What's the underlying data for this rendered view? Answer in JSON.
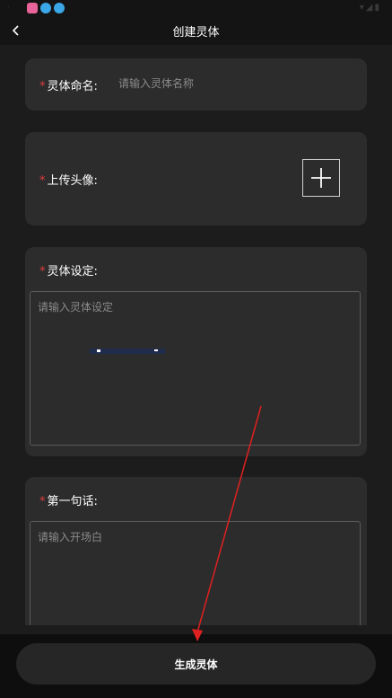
{
  "header": {
    "title": "创建灵体"
  },
  "form": {
    "name": {
      "label": "灵体命名:",
      "placeholder": "请输入灵体名称",
      "value": ""
    },
    "avatar": {
      "label": "上传头像:"
    },
    "setting": {
      "label": "灵体设定:",
      "placeholder": "请输入灵体设定",
      "value": ""
    },
    "first_sentence": {
      "label": "第一句话:",
      "placeholder": "请输入开场白",
      "value": ""
    },
    "required_mark": "*"
  },
  "footer": {
    "generate_label": "生成灵体"
  },
  "icons": {
    "back": "chevron-left-icon",
    "upload": "plus-icon"
  },
  "colors": {
    "background": "#1c1c1c",
    "card": "#2c2c2c",
    "required": "#e23b3b",
    "annotation_arrow": "#e02020"
  }
}
